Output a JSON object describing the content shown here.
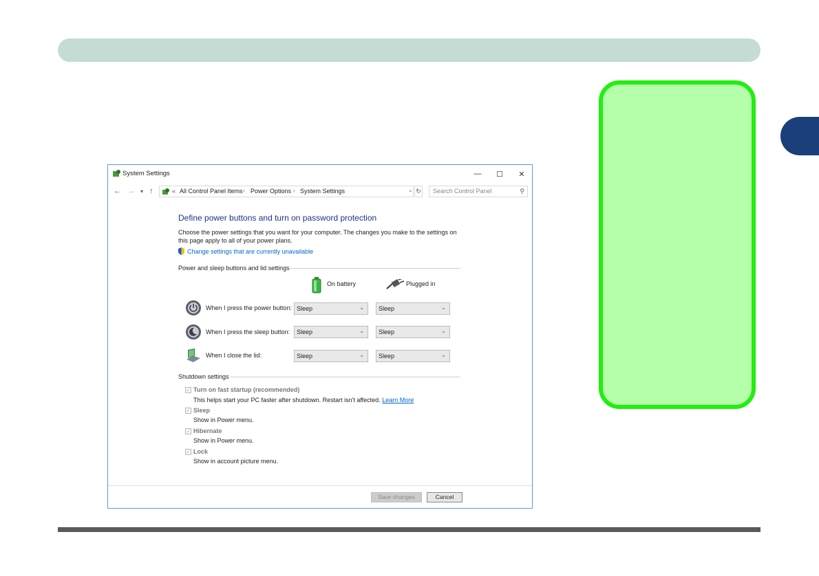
{
  "window": {
    "title": "System Settings",
    "minimize": "—",
    "maximize": "☐",
    "close": "✕"
  },
  "nav": {
    "back": "←",
    "forward": "→",
    "recent": "▾",
    "up": "↑",
    "overflow": "«",
    "breadcrumbs": [
      "All Control Panel Items",
      "Power Options",
      "System Settings"
    ],
    "separator": "›",
    "dropdown": "⌄",
    "refresh": "↻",
    "search_placeholder": "Search Control Panel",
    "search_glyph": "⚲"
  },
  "content": {
    "heading": "Define power buttons and turn on password protection",
    "description": "Choose the power settings that you want for your computer. The changes you make to the settings on this page apply to all of your power plans.",
    "uac_link": "Change settings that are currently unavailable",
    "power_section": "Power and sleep buttons and lid settings",
    "col_battery": "On battery",
    "col_plugged": "Plugged in",
    "rows": [
      {
        "label": "When I press the power button:",
        "battery": "Sleep",
        "plugged": "Sleep",
        "icon": "power-button-icon"
      },
      {
        "label": "When I press the sleep button:",
        "battery": "Sleep",
        "plugged": "Sleep",
        "icon": "sleep-button-icon"
      },
      {
        "label": "When I close the lid:",
        "battery": "Sleep",
        "plugged": "Sleep",
        "icon": "laptop-lid-icon"
      }
    ],
    "shutdown_section": "Shutdown settings",
    "shutdown": [
      {
        "label": "Turn on fast startup (recommended)",
        "desc": "This helps start your PC faster after shutdown. Restart isn't affected.",
        "link": "Learn More",
        "checked": true
      },
      {
        "label": "Sleep",
        "desc": "Show in Power menu.",
        "checked": true
      },
      {
        "label": "Hibernate",
        "desc": "Show in Power menu.",
        "checked": true
      },
      {
        "label": "Lock",
        "desc": "Show in account picture menu.",
        "checked": true
      }
    ],
    "check_glyph": "✓",
    "select_arrow": "⌄"
  },
  "footer": {
    "save": "Save changes",
    "cancel": "Cancel"
  },
  "colors": {
    "header_bar": "#c5dcd5",
    "chapter_tab": "#1a3f7a",
    "note_fill": "#b5ffaa",
    "note_border": "#22ee11",
    "link": "#0066cc",
    "heading": "#1e3287"
  }
}
